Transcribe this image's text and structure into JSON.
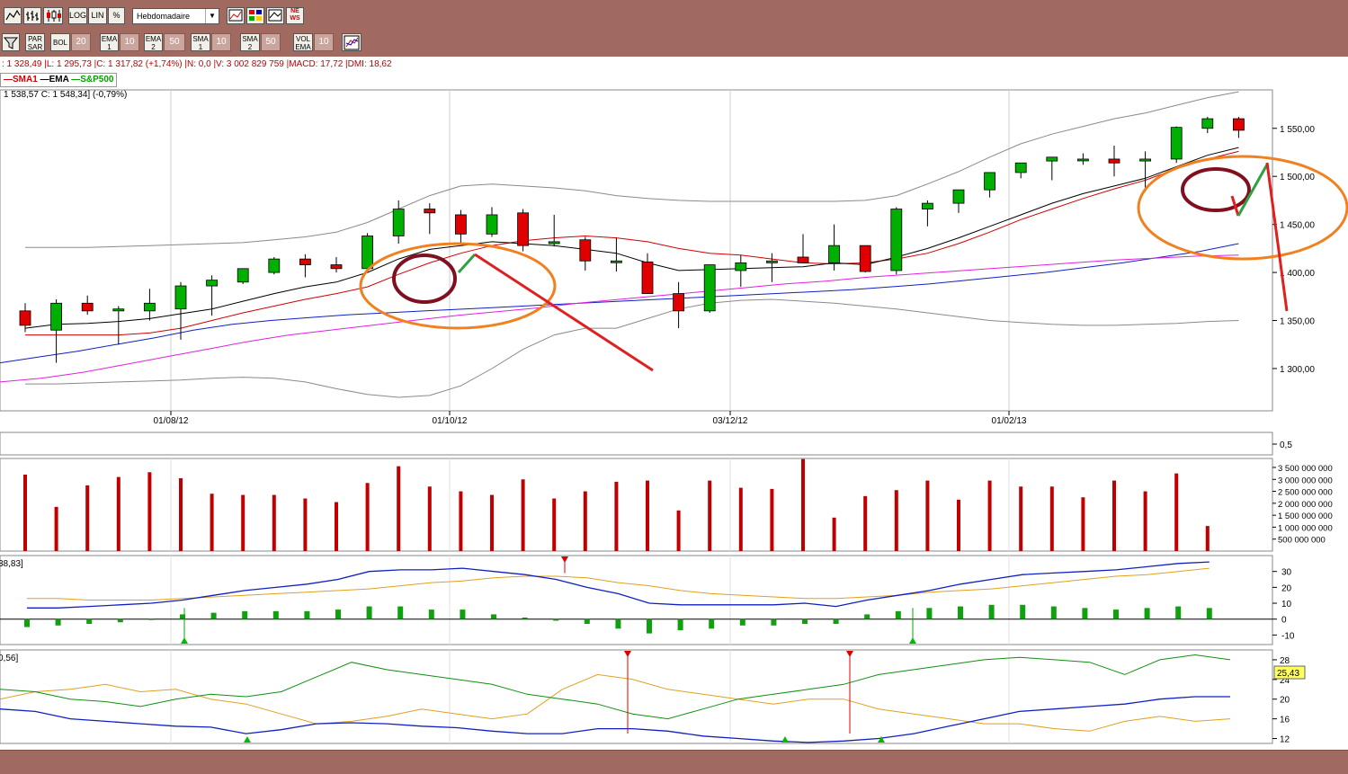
{
  "toolbar": {
    "buttons_row1": [
      "LOG",
      "LIN",
      "%"
    ],
    "timeframe": "Hebdomadaire",
    "news_label": "NE WS",
    "buttons_row2": [
      {
        "label": "PAR SAR",
        "value": ""
      },
      {
        "label": "BOL",
        "value": "20"
      },
      {
        "label": "EMA 1",
        "value": "10"
      },
      {
        "label": "EMA 2",
        "value": "50"
      },
      {
        "label": "SMA 1",
        "value": "10"
      },
      {
        "label": "SMA 2",
        "value": "50"
      },
      {
        "label": "VOL EMA",
        "value": "10"
      }
    ]
  },
  "info": {
    "ohlc_line": ": 1 328,49 |L: 1 295,73 |C: 1 317,82 (+1,74%) |N: 0,0 |V: 3 002 829 759 |MACD: 17,72 |DMI: 18,62",
    "price_line": "1 538,57  C: 1 548,34] (-0,79%)"
  },
  "legend": [
    {
      "label": "SMA1",
      "color": "#d00000"
    },
    {
      "label": "EMA",
      "color": "#000000"
    },
    {
      "label": "S&P500",
      "color": "#00a000"
    }
  ],
  "colors": {
    "up": "#00b000",
    "down": "#e00000",
    "volume": "#c00000",
    "bg_frame": "#a06a60"
  },
  "chart_data": {
    "type": "candlestick",
    "x_labels": [
      "01/08/12",
      "01/10/12",
      "03/12/12",
      "01/02/13"
    ],
    "price_ticks": [
      "1 550,00",
      "1 500,00",
      "1 450,00",
      "1 400,00",
      "1 350,00",
      "1 300,00"
    ],
    "price_ylim": [
      1256,
      1590
    ],
    "candles": [
      [
        1360,
        1368,
        1338,
        1345
      ],
      [
        1340,
        1372,
        1306,
        1368
      ],
      [
        1368,
        1376,
        1356,
        1360
      ],
      [
        1360,
        1365,
        1325,
        1362
      ],
      [
        1360,
        1383,
        1350,
        1368
      ],
      [
        1362,
        1390,
        1330,
        1386
      ],
      [
        1386,
        1397,
        1355,
        1392
      ],
      [
        1390,
        1404,
        1388,
        1404
      ],
      [
        1400,
        1416,
        1398,
        1414
      ],
      [
        1414,
        1419,
        1395,
        1408
      ],
      [
        1408,
        1416,
        1400,
        1404
      ],
      [
        1404,
        1441,
        1400,
        1438
      ],
      [
        1438,
        1475,
        1430,
        1466
      ],
      [
        1466,
        1472,
        1440,
        1462
      ],
      [
        1460,
        1465,
        1430,
        1440
      ],
      [
        1440,
        1468,
        1437,
        1460
      ],
      [
        1462,
        1466,
        1422,
        1428
      ],
      [
        1430,
        1460,
        1427,
        1432
      ],
      [
        1434,
        1437,
        1402,
        1412
      ],
      [
        1412,
        1436,
        1401,
        1412
      ],
      [
        1411,
        1420,
        1390,
        1378
      ],
      [
        1378,
        1390,
        1342,
        1360
      ],
      [
        1360,
        1408,
        1358,
        1408
      ],
      [
        1402,
        1418,
        1385,
        1410
      ],
      [
        1410,
        1420,
        1390,
        1412
      ],
      [
        1416,
        1440,
        1410,
        1410
      ],
      [
        1410,
        1450,
        1402,
        1428
      ],
      [
        1428,
        1428,
        1400,
        1401
      ],
      [
        1402,
        1468,
        1398,
        1466
      ],
      [
        1466,
        1475,
        1448,
        1472
      ],
      [
        1472,
        1486,
        1462,
        1486
      ],
      [
        1486,
        1504,
        1478,
        1504
      ],
      [
        1504,
        1514,
        1498,
        1514
      ],
      [
        1516,
        1520,
        1496,
        1520
      ],
      [
        1518,
        1524,
        1512,
        1518
      ],
      [
        1518,
        1532,
        1500,
        1514
      ],
      [
        1516,
        1526,
        1484,
        1518
      ],
      [
        1518,
        1552,
        1514,
        1551
      ],
      [
        1550,
        1562,
        1545,
        1560
      ],
      [
        1560,
        1562,
        1540,
        1548
      ]
    ],
    "ema": [
      1342,
      1346,
      1347,
      1349,
      1352,
      1357,
      1362,
      1370,
      1378,
      1385,
      1390,
      1400,
      1414,
      1424,
      1428,
      1432,
      1430,
      1428,
      1424,
      1420,
      1410,
      1402,
      1403,
      1404,
      1405,
      1406,
      1410,
      1408,
      1416,
      1425,
      1436,
      1448,
      1460,
      1472,
      1482,
      1490,
      1498,
      1510,
      1522,
      1530
    ],
    "sma1": [
      1335,
      1335,
      1335,
      1335,
      1337,
      1342,
      1350,
      1358,
      1365,
      1372,
      1378,
      1385,
      1398,
      1410,
      1420,
      1428,
      1433,
      1436,
      1438,
      1436,
      1432,
      1425,
      1420,
      1418,
      1414,
      1410,
      1409,
      1410,
      1414,
      1420,
      1430,
      1442,
      1455,
      1466,
      1477,
      1487,
      1496,
      1508,
      1518,
      1526
    ],
    "bb_upper": [
      1426,
      1426,
      1426,
      1427,
      1428,
      1429,
      1430,
      1431,
      1434,
      1437,
      1442,
      1452,
      1466,
      1480,
      1490,
      1492,
      1490,
      1488,
      1485,
      1480,
      1477,
      1475,
      1474,
      1474,
      1474,
      1474,
      1474,
      1475,
      1480,
      1492,
      1505,
      1520,
      1534,
      1544,
      1552,
      1560,
      1566,
      1574,
      1582,
      1588
    ],
    "bb_lower": [
      1284,
      1284,
      1285,
      1286,
      1287,
      1288,
      1290,
      1291,
      1290,
      1286,
      1279,
      1273,
      1270,
      1272,
      1282,
      1300,
      1320,
      1335,
      1342,
      1342,
      1352,
      1362,
      1368,
      1371,
      1372,
      1370,
      1368,
      1365,
      1362,
      1358,
      1354,
      1350,
      1348,
      1346,
      1345,
      1345,
      1346,
      1347,
      1349,
      1350
    ],
    "sma50": [
      1306,
      1312,
      1318,
      1325,
      1332,
      1340,
      1346,
      1350,
      1353,
      1356,
      1358,
      1360,
      1362,
      1364,
      1366,
      1368,
      1370,
      1372,
      1374,
      1376,
      1378,
      1380,
      1382,
      1385,
      1388,
      1392,
      1396,
      1400,
      1405,
      1410,
      1416,
      1422,
      1430
    ],
    "ema50": [
      1286,
      1290,
      1296,
      1304,
      1312,
      1320,
      1328,
      1335,
      1340,
      1345,
      1350,
      1355,
      1359,
      1363,
      1368,
      1372,
      1376,
      1380,
      1384,
      1388,
      1391,
      1395,
      1398,
      1401,
      1404,
      1407,
      1410,
      1413,
      1415,
      1417,
      1418
    ],
    "volume": {
      "ticks": [
        "3 500 000 000",
        "3 000 000 000",
        "2 500 000 000",
        "2 000 000 000",
        "1 500 000 000",
        "1 000 000 000",
        "500 000 000"
      ],
      "ylim": [
        0,
        3800000000
      ],
      "values": [
        3200000000,
        1850000000,
        2750000000,
        3100000000,
        3300000000,
        3050000000,
        2400000000,
        2350000000,
        2350000000,
        2200000000,
        2050000000,
        2850000000,
        3550000000,
        2700000000,
        2500000000,
        2350000000,
        3000000000,
        2200000000,
        2500000000,
        2900000000,
        2950000000,
        1700000000,
        2950000000,
        2650000000,
        2600000000,
        3850000000,
        1400000000,
        2300000000,
        2550000000,
        2950000000,
        2150000000,
        2950000000,
        2700000000,
        2700000000,
        2250000000,
        2950000000,
        2500000000,
        3250000000,
        1050000000
      ]
    },
    "osc_label": "0,5",
    "macd": {
      "header": "38,83]",
      "ticks": [
        "30",
        "20",
        "10",
        "0",
        "-10"
      ],
      "ylim": [
        -16,
        40
      ],
      "macd_line": [
        7,
        7,
        8,
        9,
        10,
        12,
        15,
        18,
        20,
        22,
        25,
        30,
        31,
        31,
        32,
        30,
        28,
        25,
        20,
        16,
        10,
        9,
        9,
        9,
        9,
        10,
        8,
        12,
        15,
        18,
        22,
        25,
        28,
        29,
        30,
        31,
        33,
        35,
        36
      ],
      "signal_line": [
        13,
        13,
        12,
        12,
        12,
        13,
        14,
        15,
        16,
        17,
        18,
        19,
        21,
        23,
        24,
        26,
        27,
        27,
        26,
        23,
        21,
        18,
        16,
        15,
        14,
        13,
        13,
        14,
        15,
        17,
        18,
        19,
        21,
        23,
        25,
        27,
        28,
        30,
        32
      ],
      "hist": [
        -5,
        -4,
        -3,
        -2,
        0,
        3,
        4,
        5,
        5,
        5,
        6,
        8,
        8,
        6,
        6,
        3,
        1,
        -1,
        -3,
        -6,
        -9,
        -7,
        -6,
        -4,
        -4,
        -3,
        -3,
        3,
        5,
        7,
        8,
        9,
        9,
        8,
        7,
        6,
        7,
        8,
        7
      ]
    },
    "dmi": {
      "header": "0,56]",
      "ticks": [
        "28",
        "24",
        "20",
        "16",
        "12"
      ],
      "ylim": [
        11,
        30
      ],
      "value_label": "25,43",
      "green": [
        22,
        21.5,
        20,
        19.5,
        18.5,
        20,
        21,
        20.5,
        21.5,
        24.5,
        27.5,
        26,
        25,
        24,
        23,
        21,
        20,
        19,
        17,
        16,
        18,
        20,
        21,
        22,
        23,
        25,
        26,
        27,
        28,
        28.5,
        28,
        27.5,
        25,
        28,
        29,
        28
      ],
      "orange": [
        20,
        21.5,
        22,
        23,
        21.5,
        22,
        20,
        19,
        17,
        15,
        15.5,
        16.5,
        18,
        17,
        16,
        17,
        22,
        25,
        24,
        22,
        21,
        20,
        19,
        20,
        20,
        18,
        17,
        16,
        15,
        15,
        14,
        13.5,
        15.5,
        16.5,
        15.5,
        16
      ],
      "blue": [
        18,
        17.5,
        16,
        15.5,
        15,
        14.5,
        14.3,
        13,
        13.8,
        15,
        15.2,
        15,
        14.5,
        14.2,
        13.5,
        13,
        13,
        14,
        14,
        13.5,
        12.5,
        12,
        11.5,
        11.2,
        11.5,
        12,
        13,
        14.5,
        16,
        17.5,
        18,
        18.5,
        19,
        20,
        20.5,
        20.5
      ]
    }
  }
}
